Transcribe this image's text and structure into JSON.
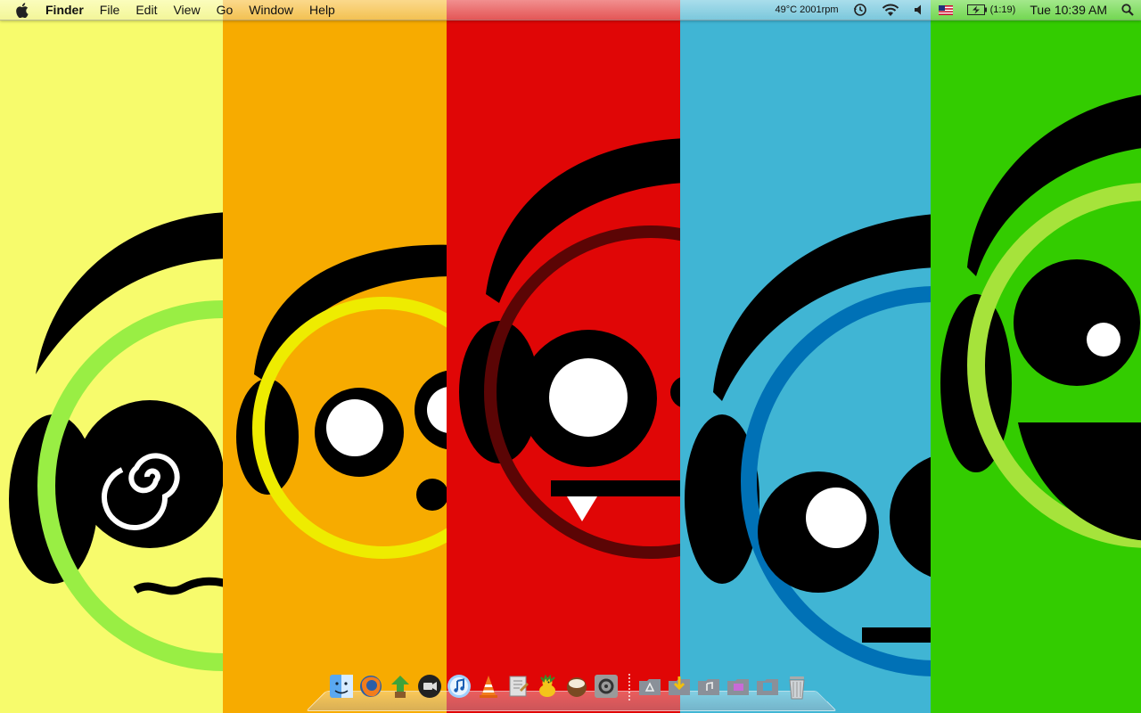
{
  "menubar": {
    "app_name": "Finder",
    "menus": [
      "File",
      "Edit",
      "View",
      "Go",
      "Window",
      "Help"
    ],
    "status": {
      "temperature": "49°C 2001rpm",
      "battery_time": "(1:19)",
      "clock": "Tue 10:39 AM"
    }
  },
  "dock": {
    "apps": [
      {
        "name": "finder",
        "icon": "finder-icon"
      },
      {
        "name": "firefox",
        "icon": "firefox-icon"
      },
      {
        "name": "transmission",
        "icon": "transmission-icon"
      },
      {
        "name": "facetime",
        "icon": "video-camera-icon"
      },
      {
        "name": "itunes",
        "icon": "itunes-icon"
      },
      {
        "name": "vlc",
        "icon": "vlc-cone-icon"
      },
      {
        "name": "script-editor",
        "icon": "script-editor-icon"
      },
      {
        "name": "adium",
        "icon": "adium-duck-icon"
      },
      {
        "name": "cocoa-app",
        "icon": "coconut-icon"
      },
      {
        "name": "system-preferences",
        "icon": "gear-icon"
      }
    ],
    "stacks": [
      {
        "name": "applications",
        "icon": "applications-folder-icon"
      },
      {
        "name": "downloads",
        "icon": "downloads-folder-icon"
      },
      {
        "name": "music",
        "icon": "music-folder-icon"
      },
      {
        "name": "pictures",
        "icon": "pictures-folder-icon"
      },
      {
        "name": "documents",
        "icon": "documents-folder-icon"
      },
      {
        "name": "trash",
        "icon": "trash-icon"
      }
    ]
  },
  "wallpaper": {
    "panels": [
      {
        "color": "#f7fb6c",
        "ring": "#99ee44",
        "expression": "dizzy"
      },
      {
        "color": "#f7ab00",
        "ring": "#eeec00",
        "expression": "surprised"
      },
      {
        "color": "#e00606",
        "ring": "#5b0505",
        "expression": "vampire"
      },
      {
        "color": "#40b5d4",
        "ring": "#0071b6",
        "expression": "neutral"
      },
      {
        "color": "#33cc00",
        "ring": "#a6e33b",
        "expression": "laughing"
      }
    ]
  }
}
